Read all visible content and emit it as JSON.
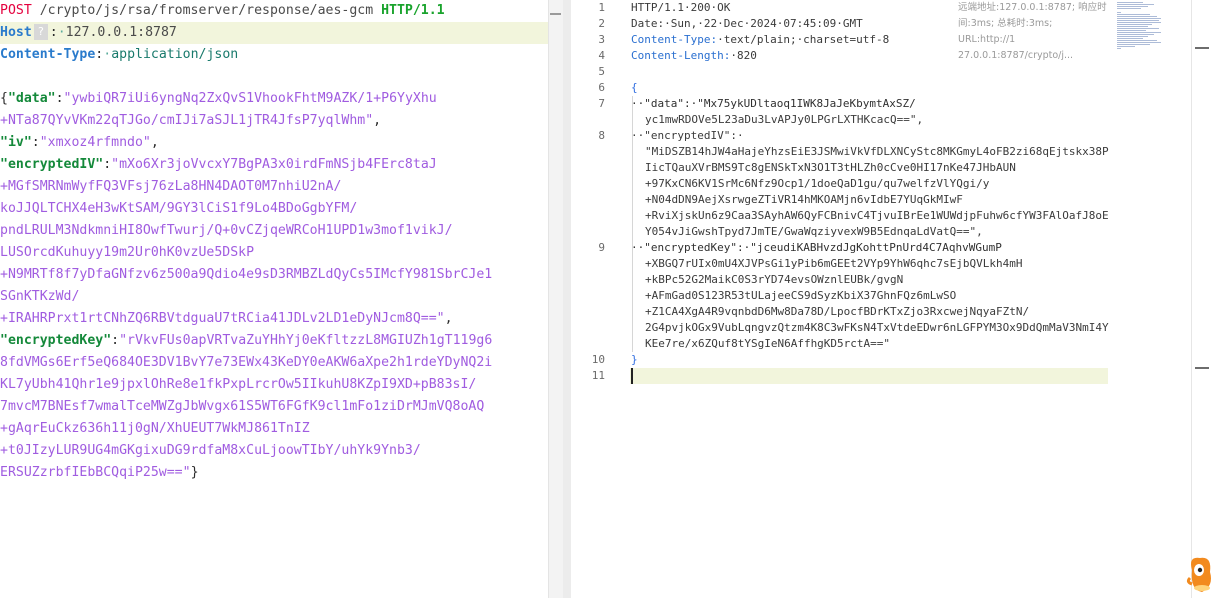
{
  "request": {
    "line1": {
      "method": "POST",
      "path": " /crypto/js/rsa/fromserver/response/aes-gcm ",
      "protocol": "HTTP/1.1"
    },
    "host": {
      "key": "Host",
      "help": "?",
      "sep": ":",
      "value": "127.0.0.1:8787"
    },
    "content_type": {
      "key": "Content-Type",
      "sep": ":",
      "value": "application/json"
    },
    "body_lines": [
      {
        "pre": "{",
        "key": "\"data\"",
        "mid": ":",
        "str": "\"ywbiQR7iUi6yngNq2ZxQvS1VhookFhtM9AZK/1+P6YyXhu",
        "post": ""
      },
      {
        "pre": "",
        "key": "",
        "mid": "",
        "str": "+NTa87QYvVKm22qTJGo/cmIJi7aSJL1jTR4JfsP7yqlWhm\"",
        "post": ","
      },
      {
        "pre": "",
        "key": "\"iv\"",
        "mid": ":",
        "str": "\"xmxoz4rfmndo\"",
        "post": ","
      },
      {
        "pre": "",
        "key": "\"encryptedIV\"",
        "mid": ":",
        "str": "\"mXo6Xr3joVvcxY7BgPA3x0irdFmNSjb4FErc8taJ",
        "post": ""
      },
      {
        "pre": "",
        "key": "",
        "mid": "",
        "str": "+MGfSMRNmWyfFQ3VFsj76zLa8HN4DAOT0M7nhiU2nA/",
        "post": ""
      },
      {
        "pre": "",
        "key": "",
        "mid": "",
        "str": "koJJQLTCHX4eH3wKtSAM/9GY3lCiS1f9Lo4BDoGgbYFM/",
        "post": ""
      },
      {
        "pre": "",
        "key": "",
        "mid": "",
        "str": "pndLRULM3NdkmniHI8OwfTwurj/Q+0vCZjqeWRCoH1UPD1w3mof1vikJ/",
        "post": ""
      },
      {
        "pre": "",
        "key": "",
        "mid": "",
        "str": "LUSOrcdKuhuyy19m2Ur0hK0vzUe5DSkP",
        "post": ""
      },
      {
        "pre": "",
        "key": "",
        "mid": "",
        "str": "+N9MRTf8f7yDfaGNfzv6z500a9Qdio4e9sD3RMBZLdQyCs5IMcfY981SbrCJe1",
        "post": ""
      },
      {
        "pre": "",
        "key": "",
        "mid": "",
        "str": "SGnKTKzWd/",
        "post": ""
      },
      {
        "pre": "",
        "key": "",
        "mid": "",
        "str": "+IRAHRPrxt1rtCNhZQ6RBVtdguaU7tRCia41JDLv2LD1eDyNJcm8Q==\"",
        "post": ","
      },
      {
        "pre": "",
        "key": "\"encryptedKey\"",
        "mid": ":",
        "str": "\"rVkvFUs0apVRTvaZuYHhYj0eKfltzzL8MGIUZh1gT119g6",
        "post": ""
      },
      {
        "pre": "",
        "key": "",
        "mid": "",
        "str": "8fdVMGs6Erf5eQ684OE3DV1BvY7e73EWx43KeDY0eAKW6aXpe2h1rdeYDyNQ2i",
        "post": ""
      },
      {
        "pre": "",
        "key": "",
        "mid": "",
        "str": "KL7yUbh41Qhr1e9jpxlOhRe8e1fkPxpLrcrOw5IIkuhU8KZpI9XD+pB83sI/",
        "post": ""
      },
      {
        "pre": "",
        "key": "",
        "mid": "",
        "str": "7mvcM7BNEsf7wmalTceMWZgJbWvgx61S5WT6FGfK9cl1mFo1ziDrMJmVQ8oAQ",
        "post": ""
      },
      {
        "pre": "",
        "key": "",
        "mid": "",
        "str": "+gAqrEuCkz636h11j0gN/XhUEUT7WkMJ861TnIZ",
        "post": ""
      },
      {
        "pre": "",
        "key": "",
        "mid": "",
        "str": "+t0JIzyLUR9UG4mGKgixuDG9rdfaM8xCuLjoowTIbY/uhYk9Ynb3/",
        "post": ""
      },
      {
        "pre": "",
        "key": "",
        "mid": "",
        "str": "ERSUZzrbfIEbBCQqiP25w==\"",
        "post": "}"
      }
    ]
  },
  "response": {
    "line_numbers": [
      "1",
      "2",
      "3",
      "4",
      "5",
      "6",
      "7",
      "8",
      "9",
      "10",
      "11"
    ],
    "status": "HTTP/1.1·200·OK",
    "date": "Date:·Sun,·22·Dec·2024·07:45:09·GMT",
    "content_type_key": "Content-Type:",
    "content_type_val": "·text/plain;·charset=utf-8",
    "content_length_key": "Content-Length:",
    "content_length_val": "·820",
    "open_brace": "{",
    "close_brace": "}",
    "data_key": "··\"data\":·",
    "data_val_1": "\"Mx75ykUDltaoq1IWK8JaJeKbymtAxSZ/",
    "data_val_2": "yc1mwRDOVe5L23aDu3LvAPJy0LPGrLXTHKcacQ==\",",
    "iv_key": "··\"encryptedIV\":·",
    "iv_lines": [
      "\"MiDSZB14hJW4aHajeYhzsEiE3JSMwiVkVfDLXNCyStc8MKGmyL4oFB2zi68qEjtskx38P",
      "IicTQauXVrBMS9Tc8gENSkTxN3O1T3tHLZh0cCve0HI17nKe47JHbAUN",
      "+97KxCN6KV1SrMc6Nfz9Ocp1/1doeQaD1gu/qu7welfzVlYQgi/y",
      "+N04dDN9AejXsrwgeZTiVR14hMKOAMjn6vIdbE7YUqGkMIwF",
      "+RviXjskUn6z9Caa3SAyhAW6QyFCBnivC4TjvuIBrEe1WUWdjpFuhw6cfYW3FAlOafJ8oE",
      "Y054vJiGwshTpyd7JmTE/GwaWqziyvexW9B5EdnqaLdVatQ==\","
    ],
    "key_key": "··\"encryptedKey\":·",
    "key_val_1": "\"jceudiKABHvzdJgKohttPnUrd4C7AqhvWGumP",
    "key_lines": [
      "+XBGQ7rUIx0mU4XJVPsGi1yPib6mGEEt2VYp9YhW6qhc7sEjbQVLkh4mH",
      "+kBPc52G2MaikC0S3rYD74evsOWznlEUBk/gvgN",
      "+AFmGad0S123R53tULajeeCS9dSyzKbiX37GhnFQz6mLwSO",
      "+Z1CA4XgA4R9vqnbdD6Mw8Da78D/LpocfBDrKTxZjo3RxcwejNqyaFZtN/",
      "2G4pvjkOGx9VubLqngvzQtzm4K8C3wFKsN4TxVtdeEDwr6nLGFPYM3Ox9DdQmMaV3NmI4Y",
      "KEe7re/x6ZQuf8tYSgIeN6AffhgKD5rctA==\""
    ],
    "meta_1": "远端地址:127.0.0.1:8787; 响应时",
    "meta_2": "间:3ms; 总耗时:3ms; URL:http://1",
    "meta_3": "27.0.0.1:8787/crypto/j..."
  },
  "colors": {
    "method": "#e4003e",
    "protocol": "#19a32c",
    "header_key": "#2a7bcc",
    "json_key": "#14893a",
    "json_string": "#a05ce0",
    "current_line": "#f2f5dc"
  }
}
